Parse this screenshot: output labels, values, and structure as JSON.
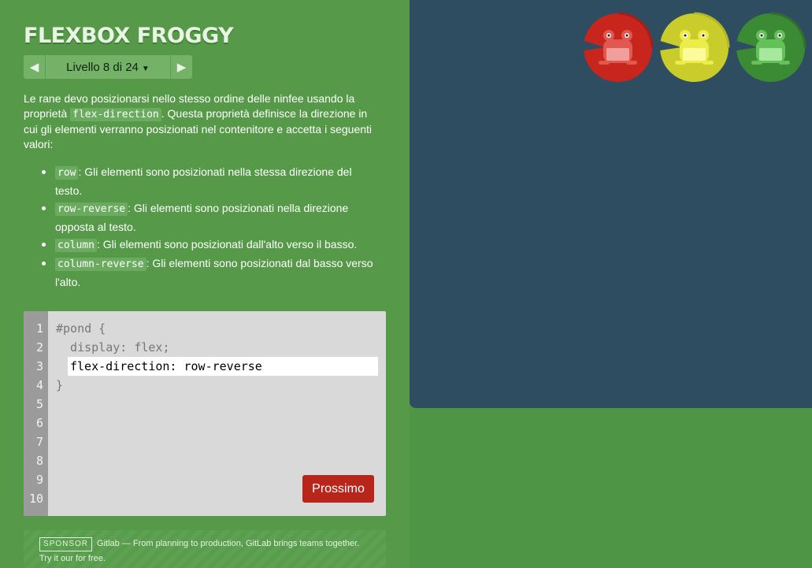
{
  "app": {
    "title": "FLEXBOX FROGGY",
    "level_label": "Livello 8 di 24",
    "prev_icon": "chevron-left-icon",
    "next_icon": "chevron-right-icon",
    "dropdown_icon": "caret-down-icon"
  },
  "instructions": {
    "intro_before": "Le rane devo posizionarsi nello stesso ordine delle ninfee usando la proprietà ",
    "intro_code": "flex-direction",
    "intro_after": ". Questa proprietà definisce la direzione in cui gli elementi verranno posizionati nel contenitore e accetta i seguenti valori:",
    "values": [
      {
        "code": "row",
        "text": ": Gli elementi sono posizionati nella stessa direzione del testo."
      },
      {
        "code": "row-reverse",
        "text": ": Gli elementi sono posizionati nella direzione opposta al testo."
      },
      {
        "code": "column",
        "text": ": Gli elementi sono posizionati dall'alto verso il basso."
      },
      {
        "code": "column-reverse",
        "text": ": Gli elementi sono posizionati dal basso verso l'alto."
      }
    ]
  },
  "editor": {
    "line_numbers": [
      "1",
      "2",
      "3",
      "4",
      "5",
      "6",
      "7",
      "8",
      "9",
      "10"
    ],
    "line1": "#pond {",
    "line2": "  display: flex;",
    "input_value": "flex-direction: row-reverse",
    "line4": "}",
    "next_label": "Prossimo"
  },
  "sponsor": {
    "badge": "SPONSOR",
    "text": "Gitlab — From planning to production, GitLab brings teams together. Try it our for free."
  },
  "board": {
    "frogs": [
      {
        "color": "red",
        "pad": "#c8261d",
        "body": "#e0584f"
      },
      {
        "color": "yellow",
        "pad": "#c9cc2b",
        "body": "#ecec4a"
      },
      {
        "color": "green",
        "pad": "#3b8a34",
        "body": "#64c15a"
      }
    ]
  },
  "colors": {
    "sidebar": "#569949",
    "board": "#2f4d61",
    "next_button": "#b8251b"
  }
}
